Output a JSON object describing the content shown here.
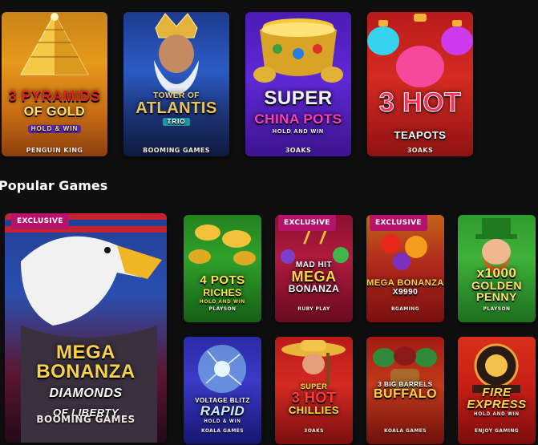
{
  "top_row": [
    {
      "logo_lines": [
        "3 PYRAMIDS",
        "OF GOLD",
        "HOLD & WIN"
      ],
      "provider": "PENGUIN KING"
    },
    {
      "logo_lines": [
        "TOWER OF",
        "ATLANTIS",
        "TRIO"
      ],
      "provider": "BOOMING GAMES"
    },
    {
      "logo_lines": [
        "SUPER",
        "CHINA POTS",
        "HOLD AND WIN"
      ],
      "provider": "3OAKS"
    },
    {
      "logo_lines": [
        "3 HOT",
        "TEAPOTS"
      ],
      "provider": "3OAKS"
    }
  ],
  "section": {
    "title": "Popular Games"
  },
  "featured": {
    "badge": "EXCLUSIVE",
    "logo_lines": [
      "MEGA BONANZA",
      "DIAMONDS",
      "OF LIBERTY"
    ],
    "provider": "BOOMING GAMES"
  },
  "grid": [
    {
      "logo_lines": [
        "4 POTS",
        "RICHES",
        "HOLD AND WIN"
      ],
      "provider": "PLAYSON",
      "badge": ""
    },
    {
      "logo_lines": [
        "MAD HIT",
        "MEGA",
        "BONANZA"
      ],
      "provider": "RUBY PLAY",
      "badge": "EXCLUSIVE"
    },
    {
      "logo_lines": [
        "MEGA BONANZA",
        "X9990"
      ],
      "provider": "BGAMING",
      "badge": "EXCLUSIVE"
    },
    {
      "logo_lines": [
        "x1000",
        "GOLDEN",
        "PENNY"
      ],
      "provider": "PLAYSON",
      "badge": ""
    },
    {
      "logo_lines": [
        "VOLTAGE BLITZ",
        "RAPID",
        "HOLD & WIN"
      ],
      "provider": "KOALA GAMES",
      "badge": ""
    },
    {
      "logo_lines": [
        "SUPER",
        "3 HOT",
        "CHILLIES"
      ],
      "provider": "3OAKS",
      "badge": ""
    },
    {
      "logo_lines": [
        "3 BIG BARRELS",
        "BUFFALO"
      ],
      "provider": "KOALA GAMES",
      "badge": ""
    },
    {
      "logo_lines": [
        "FIRE",
        "EXPRESS",
        "HOLD AND WIN"
      ],
      "provider": "ENJOY GAMING",
      "badge": ""
    }
  ]
}
